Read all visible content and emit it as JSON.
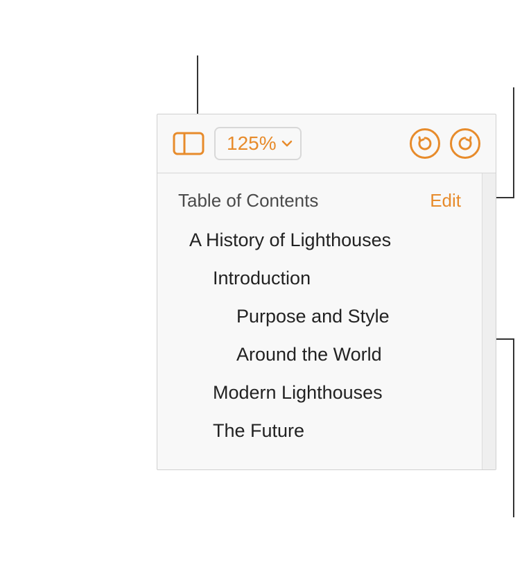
{
  "toolbar": {
    "zoom_value": "125%"
  },
  "sidebar": {
    "title": "Table of Contents",
    "edit_label": "Edit",
    "items": [
      {
        "label": "A History of Lighthouses",
        "indent": 0
      },
      {
        "label": "Introduction",
        "indent": 1
      },
      {
        "label": "Purpose and Style",
        "indent": 2
      },
      {
        "label": "Around the World",
        "indent": 2
      },
      {
        "label": "Modern Lighthouses",
        "indent": 1
      },
      {
        "label": "The Future",
        "indent": 1
      }
    ]
  },
  "accent_color": "#e78b2b"
}
